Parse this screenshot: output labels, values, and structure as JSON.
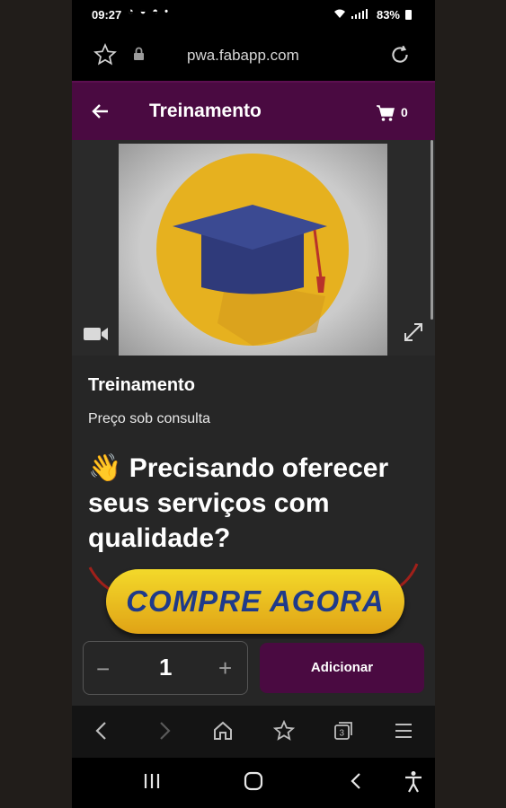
{
  "status": {
    "time": "09:27",
    "notif_icons": "◔ ◒ ◓ •",
    "battery": "83%"
  },
  "browser": {
    "url": "pwa.fabapp.com"
  },
  "appbar": {
    "title": "Treinamento",
    "cart_count": "0"
  },
  "product": {
    "title": "Treinamento",
    "price": "Preço sob consulta",
    "headline": "👋 Precisando oferecer seus serviços com qualidade?",
    "cta_label": "COMPRE AGORA"
  },
  "actions": {
    "minus": "−",
    "quantity": "1",
    "plus": "+",
    "add_label": "Adicionar"
  },
  "colors": {
    "brand": "#4a0a41",
    "cap": "#2f3a7a",
    "circle": "#e8b020"
  }
}
